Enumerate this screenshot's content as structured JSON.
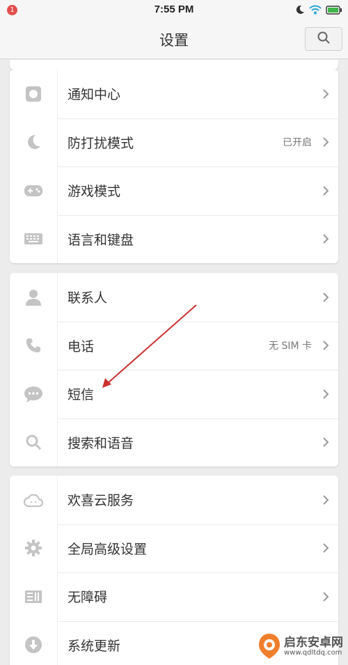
{
  "status_bar": {
    "notification_badge": "1",
    "time": "7:55 PM",
    "icons": [
      "moon-icon",
      "wifi-icon",
      "battery-icon"
    ]
  },
  "header": {
    "title": "设置",
    "search_icon": "search-icon"
  },
  "groups": [
    {
      "items": [
        {
          "icon": "notification-center-icon",
          "label": "通知中心",
          "value": ""
        },
        {
          "icon": "moon-icon",
          "label": "防打扰模式",
          "value": "已开启"
        },
        {
          "icon": "gamepad-icon",
          "label": "游戏模式",
          "value": ""
        },
        {
          "icon": "keyboard-icon",
          "label": "语言和键盘",
          "value": ""
        }
      ]
    },
    {
      "items": [
        {
          "icon": "contact-icon",
          "label": "联系人",
          "value": ""
        },
        {
          "icon": "phone-icon",
          "label": "电话",
          "value": "无 SIM 卡"
        },
        {
          "icon": "message-icon",
          "label": "短信",
          "value": ""
        },
        {
          "icon": "search-icon",
          "label": "搜索和语音",
          "value": ""
        }
      ]
    },
    {
      "items": [
        {
          "icon": "cloud-icon",
          "label": "欢喜云服务",
          "value": ""
        },
        {
          "icon": "gear-icon",
          "label": "全局高级设置",
          "value": ""
        },
        {
          "icon": "accessibility-icon",
          "label": "无障碍",
          "value": ""
        },
        {
          "icon": "download-icon",
          "label": "系统更新",
          "value": ""
        }
      ]
    }
  ],
  "watermark": {
    "text": "启东安卓网",
    "url": "www.qdltdq.com"
  },
  "colors": {
    "background": "#ececec",
    "card": "#ffffff",
    "icon": "#c4c4c4",
    "arrow": "#c9302c"
  }
}
